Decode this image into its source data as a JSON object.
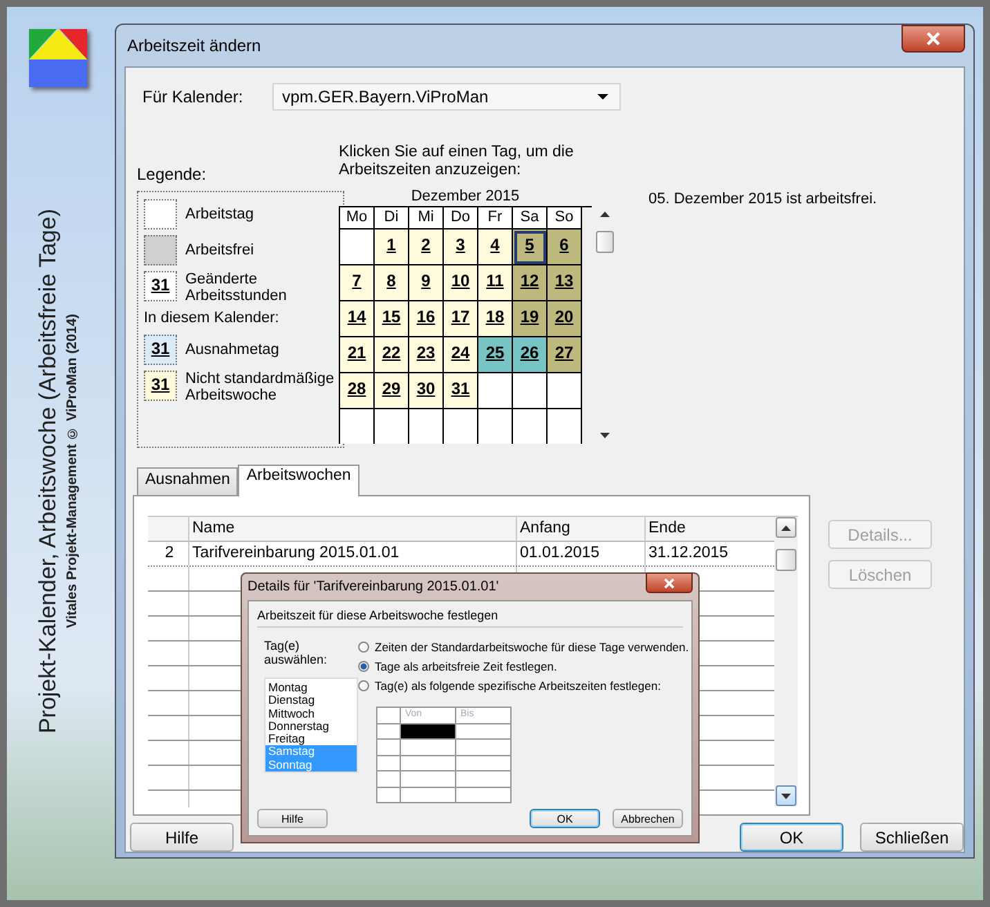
{
  "sidebar": {
    "title": "Projekt-Kalender, Arbeitswoche (Arbeitsfreie Tage)",
    "subtitle": "Vitales Projekt-Management © ViProMan (2014)"
  },
  "window": {
    "title": "Arbeitszeit ändern"
  },
  "calendar_field": {
    "label": "Für Kalender:",
    "value": "vpm.GER.Bayern.ViProMan"
  },
  "legend": {
    "title": "Legende:",
    "items": [
      {
        "kind": "working",
        "label": "Arbeitstag"
      },
      {
        "kind": "free",
        "label": "Arbeitsfrei"
      },
      {
        "kind": "changed",
        "sample": "31",
        "label": "Geänderte Arbeitsstunden"
      },
      {
        "kind": "heading",
        "label": "In diesem Kalender:"
      },
      {
        "kind": "exception",
        "sample": "31",
        "label": "Ausnahmetag"
      },
      {
        "kind": "nonstandard",
        "sample": "31",
        "label": "Nicht standardmäßige Arbeitswoche"
      }
    ]
  },
  "calendar": {
    "instruction": "Klicken Sie auf einen Tag, um die Arbeitszeiten anzuzeigen:",
    "month": "Dezember 2015",
    "weekdays": [
      "Mo",
      "Di",
      "Mi",
      "Do",
      "Fr",
      "Sa",
      "So"
    ],
    "weeks": [
      [
        {
          "kind": "blank",
          "selected": false
        },
        {
          "kind": "nonstandard",
          "day": "1",
          "selected": false
        },
        {
          "kind": "nonstandard",
          "day": "2",
          "selected": false
        },
        {
          "kind": "nonstandard",
          "day": "3",
          "selected": false
        },
        {
          "kind": "nonstandard",
          "day": "4",
          "selected": false
        },
        {
          "kind": "free",
          "day": "5",
          "selected": true
        },
        {
          "kind": "free",
          "day": "6",
          "selected": false
        }
      ],
      [
        {
          "kind": "nonstandard",
          "day": "7",
          "selected": false
        },
        {
          "kind": "nonstandard",
          "day": "8",
          "selected": false
        },
        {
          "kind": "nonstandard",
          "day": "9",
          "selected": false
        },
        {
          "kind": "nonstandard",
          "day": "10",
          "selected": false
        },
        {
          "kind": "nonstandard",
          "day": "11",
          "selected": false
        },
        {
          "kind": "free",
          "day": "12",
          "selected": false
        },
        {
          "kind": "free",
          "day": "13",
          "selected": false
        }
      ],
      [
        {
          "kind": "nonstandard",
          "day": "14",
          "selected": false
        },
        {
          "kind": "nonstandard",
          "day": "15",
          "selected": false
        },
        {
          "kind": "nonstandard",
          "day": "16",
          "selected": false
        },
        {
          "kind": "nonstandard",
          "day": "17",
          "selected": false
        },
        {
          "kind": "nonstandard",
          "day": "18",
          "selected": false
        },
        {
          "kind": "free",
          "day": "19",
          "selected": false
        },
        {
          "kind": "free",
          "day": "20",
          "selected": false
        }
      ],
      [
        {
          "kind": "nonstandard",
          "day": "21",
          "selected": false
        },
        {
          "kind": "nonstandard",
          "day": "22",
          "selected": false
        },
        {
          "kind": "nonstandard",
          "day": "23",
          "selected": false
        },
        {
          "kind": "nonstandard",
          "day": "24",
          "selected": false
        },
        {
          "kind": "exception",
          "day": "25",
          "selected": false
        },
        {
          "kind": "exception",
          "day": "26",
          "selected": false
        },
        {
          "kind": "free",
          "day": "27",
          "selected": false
        }
      ],
      [
        {
          "kind": "nonstandard",
          "day": "28",
          "selected": false
        },
        {
          "kind": "nonstandard",
          "day": "29",
          "selected": false
        },
        {
          "kind": "nonstandard",
          "day": "30",
          "selected": false
        },
        {
          "kind": "nonstandard",
          "day": "31",
          "selected": false
        },
        {
          "kind": "blank",
          "selected": false
        },
        {
          "kind": "blank",
          "selected": false
        },
        {
          "kind": "blank",
          "selected": false
        }
      ],
      [
        {
          "kind": "blank",
          "selected": false
        },
        {
          "kind": "blank",
          "selected": false
        },
        {
          "kind": "blank",
          "selected": false
        },
        {
          "kind": "blank",
          "selected": false
        },
        {
          "kind": "blank",
          "selected": false
        },
        {
          "kind": "blank",
          "selected": false
        },
        {
          "kind": "blank",
          "selected": false
        }
      ]
    ]
  },
  "day_info": "05. Dezember 2015 ist arbeitsfrei.",
  "tabs": [
    {
      "label": "Ausnahmen",
      "selected": false
    },
    {
      "label": "Arbeitswochen",
      "selected": true
    }
  ],
  "table": {
    "columns": [
      "Name",
      "Anfang",
      "Ende"
    ],
    "rows": [
      {
        "number": "2",
        "name": "Tarifvereinbarung 2015.01.01",
        "start": "01.01.2015",
        "end": "31.12.2015"
      }
    ]
  },
  "side_buttons": [
    {
      "label": "Details...",
      "disabled": true
    },
    {
      "label": "Löschen",
      "disabled": true
    }
  ],
  "buttons": [
    {
      "label": "Hilfe",
      "default": false
    },
    {
      "label": "OK",
      "default": true
    },
    {
      "label": "Schließen",
      "default": false
    }
  ],
  "details_dialog": {
    "title": "Details für 'Tarifvereinbarung 2015.01.01'",
    "group": "Arbeitszeit für diese Arbeitswoche festlegen",
    "days_label": "Tag(e) auswählen:",
    "days": [
      {
        "label": "Montag",
        "selected": false
      },
      {
        "label": "Dienstag",
        "selected": false
      },
      {
        "label": "Mittwoch",
        "selected": false
      },
      {
        "label": "Donnerstag",
        "selected": false
      },
      {
        "label": "Freitag",
        "selected": false
      },
      {
        "label": "Samstag",
        "selected": true
      },
      {
        "label": "Sonntag",
        "selected": true
      }
    ],
    "options": [
      {
        "label": "Zeiten der Standardarbeitswoche für diese Tage verwenden.",
        "selected": false
      },
      {
        "label": "Tage als arbeitsfreie Zeit festlegen.",
        "selected": true
      },
      {
        "label": "Tag(e) als folgende spezifische Arbeitszeiten festlegen:",
        "selected": false
      }
    ],
    "grid": {
      "columns": [
        "Von",
        "Bis"
      ],
      "disabled": true,
      "rows": [
        {
          "selected": true
        },
        {
          "selected": false
        },
        {
          "selected": false
        },
        {
          "selected": false
        },
        {
          "selected": false
        }
      ]
    },
    "buttons": [
      {
        "label": "Hilfe",
        "default": false
      },
      {
        "label": "OK",
        "default": true
      },
      {
        "label": "Abbrechen",
        "default": false
      }
    ]
  }
}
